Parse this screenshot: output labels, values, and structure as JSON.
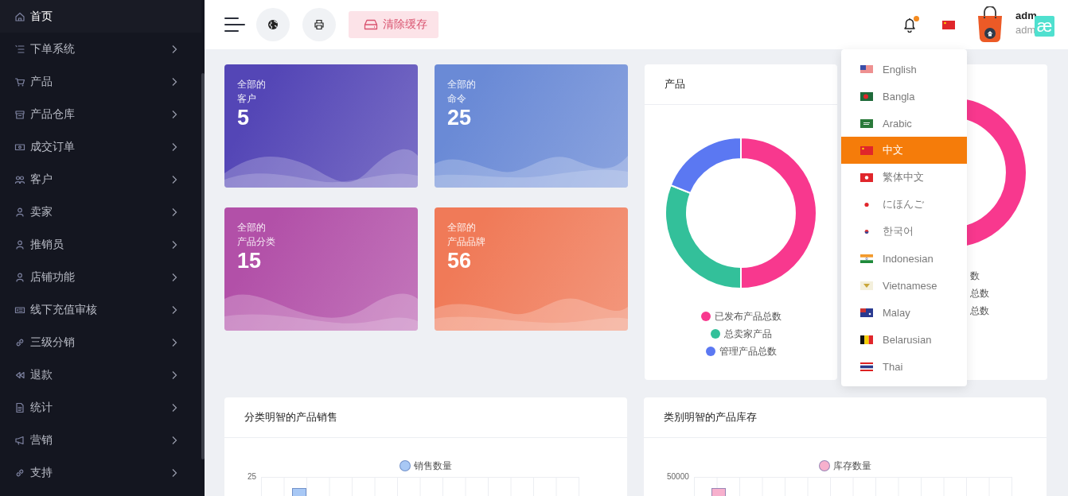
{
  "sidebar": {
    "items": [
      {
        "label": "首页",
        "kind": "home",
        "selected": true,
        "has_submenu": false
      },
      {
        "label": "下单系统",
        "kind": "list",
        "selected": false,
        "has_submenu": true
      },
      {
        "label": "产品",
        "kind": "cart",
        "selected": false,
        "has_submenu": true
      },
      {
        "label": "产品仓库",
        "kind": "box",
        "selected": false,
        "has_submenu": true
      },
      {
        "label": "成交订单",
        "kind": "money",
        "selected": false,
        "has_submenu": true
      },
      {
        "label": "客户",
        "kind": "users",
        "selected": false,
        "has_submenu": true
      },
      {
        "label": "卖家",
        "kind": "user",
        "selected": false,
        "has_submenu": true
      },
      {
        "label": "推销员",
        "kind": "user",
        "selected": false,
        "has_submenu": true
      },
      {
        "label": "店铺功能",
        "kind": "user",
        "selected": false,
        "has_submenu": true
      },
      {
        "label": "线下充值审核",
        "kind": "ticket",
        "selected": false,
        "has_submenu": true
      },
      {
        "label": "三级分销",
        "kind": "link",
        "selected": false,
        "has_submenu": true
      },
      {
        "label": "退款",
        "kind": "rewind",
        "selected": false,
        "has_submenu": true
      },
      {
        "label": "统计",
        "kind": "doc",
        "selected": false,
        "has_submenu": true
      },
      {
        "label": "营销",
        "kind": "megaphone",
        "selected": false,
        "has_submenu": true
      },
      {
        "label": "支持",
        "kind": "link",
        "selected": false,
        "has_submenu": true
      }
    ]
  },
  "header": {
    "clear_cache_button": "清除缓存",
    "notification_dot": true,
    "user_name": "adm",
    "user_role": "adm",
    "logo_text": "æ"
  },
  "stat_cards": [
    {
      "caption": "全部的",
      "label": "客户",
      "value": "5",
      "color": "#5446b6"
    },
    {
      "caption": "全部的",
      "label": "命令",
      "value": "25",
      "color": "#6a8ad6"
    },
    {
      "caption": "全部的",
      "label": "产品分类",
      "value": "15",
      "color": "#b250a8"
    },
    {
      "caption": "全部的",
      "label": "产品品牌",
      "value": "56",
      "color": "#f07a58"
    }
  ],
  "product_card": {
    "title": "产品",
    "legend": [
      {
        "label": "已发布产品总数",
        "color": "#f8388e"
      },
      {
        "label": "总卖家产品",
        "color": "#33c09a"
      },
      {
        "label": "管理产品总数",
        "color": "#5b78f2"
      }
    ]
  },
  "second_donut_card": {
    "legend": [
      {
        "label": "数"
      },
      {
        "label": "总数"
      },
      {
        "label": "总数"
      }
    ]
  },
  "language_menu": {
    "items": [
      {
        "label": "English",
        "kind": "us",
        "selected": false
      },
      {
        "label": "Bangla",
        "kind": "bd",
        "selected": false
      },
      {
        "label": "Arabic",
        "kind": "sa",
        "selected": false
      },
      {
        "label": "中文",
        "kind": "cn",
        "selected": true
      },
      {
        "label": "繁体中文",
        "kind": "hk",
        "selected": false
      },
      {
        "label": "にほんご",
        "kind": "jp",
        "selected": false
      },
      {
        "label": "한국어",
        "kind": "kr",
        "selected": false
      },
      {
        "label": "Indonesian",
        "kind": "in",
        "selected": false
      },
      {
        "label": "Vietnamese",
        "kind": "vn",
        "selected": false
      },
      {
        "label": "Malay",
        "kind": "my",
        "selected": false
      },
      {
        "label": "Belarusian",
        "kind": "by",
        "selected": false
      },
      {
        "label": "Thai",
        "kind": "th",
        "selected": false
      }
    ]
  },
  "bar_cards": [
    {
      "title": "分类明智的产品销售",
      "legend": "销售数量",
      "color": "#a8c8f5",
      "y_tick": "25"
    },
    {
      "title": "类别明智的产品库存",
      "legend": "库存数量",
      "color": "#f7b0cd",
      "y_tick": "50000"
    }
  ]
}
